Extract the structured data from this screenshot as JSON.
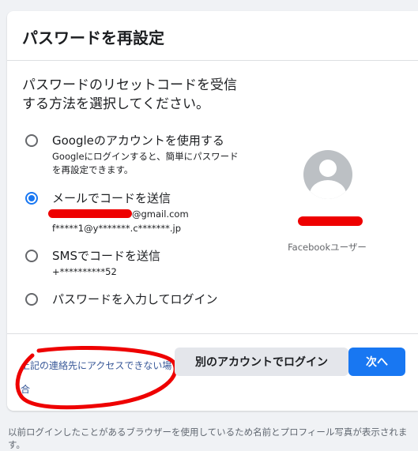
{
  "dialog": {
    "title": "パスワードを再設定",
    "intro": "パスワードのリセットコードを受信する方法を選択してください。"
  },
  "options": [
    {
      "label": "Googleのアカウントを使用する",
      "description": "Googleにログインすると、簡単にパスワードを再設定できます。",
      "checked": false
    },
    {
      "label": "メールでコードを送信",
      "email_suffix": "@gmail.com",
      "email_masked": "f*****1@y*******.c*******.jp",
      "checked": true
    },
    {
      "label": "SMSでコードを送信",
      "phone_masked": "+**********52",
      "checked": false
    },
    {
      "label": "パスワードを入力してログイン",
      "checked": false
    }
  ],
  "profile": {
    "name": "Facebookユーザー"
  },
  "footer": {
    "help_link": "上記の連絡先にアクセスできない場合",
    "other_account_button": "別のアカウントでログイン",
    "next_button": "次へ"
  },
  "footnote": "以前ログインしたことがあるブラウザーを使用しているため名前とプロフィール写真が表示されます。",
  "colors": {
    "accent": "#1877f2",
    "link": "#385898",
    "redaction": "#ee0000",
    "page_background": "#f0f2f5"
  }
}
